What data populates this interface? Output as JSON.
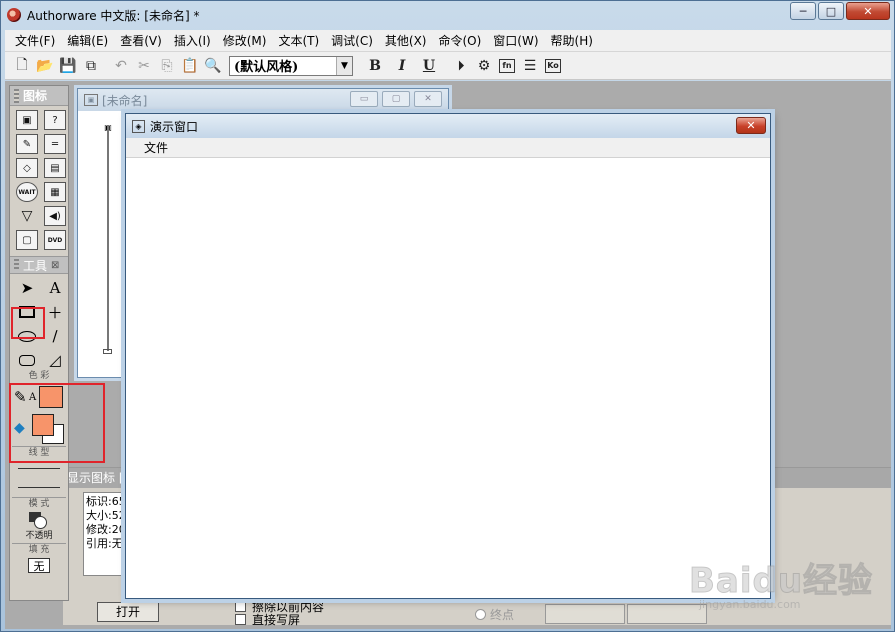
{
  "window": {
    "title": "Authorware 中文版: [未命名] *",
    "minimize_label": "─",
    "maximize_label": "□",
    "close_label": "✕"
  },
  "menubar": {
    "items": [
      "文件(F)",
      "编辑(E)",
      "查看(V)",
      "插入(I)",
      "修改(M)",
      "文本(T)",
      "调试(C)",
      "其他(X)",
      "命令(O)",
      "窗口(W)",
      "帮助(H)"
    ]
  },
  "toolbar": {
    "style_value": "(默认风格)",
    "bold_label": "B",
    "italic_label": "I",
    "underline_label": "U",
    "fn_label": "fn",
    "ko_label": "Ko"
  },
  "icon_palette": {
    "title": "图标",
    "icons": [
      "display-icon",
      "interaction-icon",
      "calculation-icon",
      "motion-icon",
      "erase-icon",
      "navigate-icon",
      "wait-icon",
      "movie-icon",
      "decision-icon",
      "sound-icon",
      "map-icon",
      "video-icon"
    ],
    "wait_text": "WAIT",
    "dvd_text": "DVD"
  },
  "tools_palette": {
    "title": "工具",
    "color_section": "色 彩",
    "line_section": "线 型",
    "mode_section": "模 式",
    "mode_value": "不透明",
    "fill_section": "填 充",
    "fill_value": "无",
    "highlight_color": "#e0242b",
    "fill_color": "#f7946a"
  },
  "flowline_window": {
    "title": "[未命名]"
  },
  "properties": {
    "strip_text": "显示图标 [",
    "info_lines": [
      "标识:65",
      "大小:52",
      "修改:20",
      "引用:无"
    ],
    "open_button": "打开",
    "erase_checkbox": "擦除以前内容",
    "direct_checkbox": "直接写屏",
    "end_radio": "终点"
  },
  "presentation_window": {
    "title": "演示窗口",
    "menu": [
      "文件"
    ],
    "close_label": "✕"
  },
  "watermark": {
    "logo": "Baidu经验",
    "url": "jingyan.baidu.com"
  }
}
